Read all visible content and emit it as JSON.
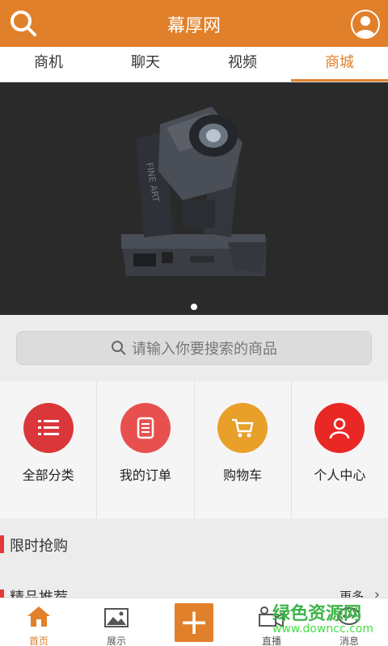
{
  "app": {
    "title": "幕厚网"
  },
  "tabs": [
    {
      "label": "商机"
    },
    {
      "label": "聊天"
    },
    {
      "label": "视频"
    },
    {
      "label": "商城"
    }
  ],
  "search": {
    "placeholder": "请输入你要搜索的商品"
  },
  "categories": [
    {
      "label": "全部分类",
      "icon": "list-icon",
      "color": "#d9373a"
    },
    {
      "label": "我的订单",
      "icon": "order-icon",
      "color": "#e85050"
    },
    {
      "label": "购物车",
      "icon": "cart-icon",
      "color": "#e8a02a"
    },
    {
      "label": "个人中心",
      "icon": "user-icon",
      "color": "#e92826"
    }
  ],
  "sections": {
    "flash_sale": "限时抢购",
    "recommended": "精品推荐",
    "more": "更多"
  },
  "bottom_nav": [
    {
      "label": "首页",
      "icon": "home-icon",
      "active": true
    },
    {
      "label": "展示",
      "icon": "image-icon"
    },
    {
      "label": "",
      "icon": "plus-icon"
    },
    {
      "label": "直播",
      "icon": "video-camera-icon"
    },
    {
      "label": "消息",
      "icon": "message-icon"
    }
  ],
  "watermark": {
    "main": "绿色资源网",
    "sub": "www.downcc.com"
  },
  "product_image": {
    "brand_text": "FINE ART"
  },
  "colors": {
    "accent": "#e1802a",
    "section_bar": "#e53939"
  }
}
